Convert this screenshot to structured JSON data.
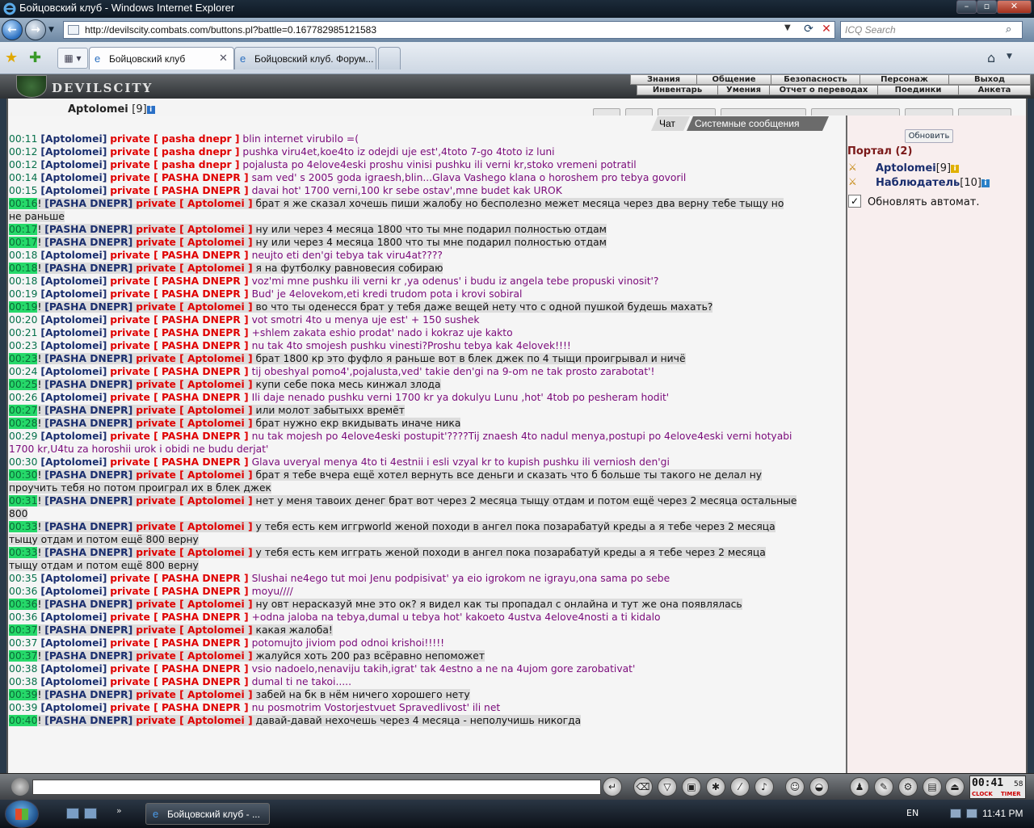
{
  "window": {
    "title": "Бойцовский клуб - Windows Internet Explorer"
  },
  "browser": {
    "url": "http://devilscity.combats.com/buttons.pl?battle=0.167782985121583",
    "search_placeholder": "ICQ Search",
    "tabs": [
      {
        "label": "Бойцовский клуб",
        "active": true
      },
      {
        "label": "Бойцовский клуб. Форум...",
        "active": false
      }
    ]
  },
  "game": {
    "logo_text": "DEVILSCITY",
    "menu_top": [
      "Знания",
      "Общение",
      "Безопасность",
      "Персонаж",
      "Выход"
    ],
    "menu_bottom": [
      "Инвентарь",
      "Умения",
      "Отчет о переводах",
      "Поединки",
      "Анкета"
    ],
    "user": {
      "name": "Aptolomei",
      "level": "[9]"
    }
  },
  "chat": {
    "tabs": [
      "Чат",
      "Системные сообщения"
    ],
    "messages": [
      {
        "time": "00:11",
        "hl": false,
        "from": "Aptolomei",
        "to": "pasha dnepr",
        "text": "blin internet virubilo =(",
        "dir": "out"
      },
      {
        "time": "00:12",
        "hl": false,
        "from": "Aptolomei",
        "to": "pasha dnepr",
        "text": "pushka viru4et,koe4to iz odejdi uje est',4toto 7-go 4toto iz luni",
        "dir": "out"
      },
      {
        "time": "00:12",
        "hl": false,
        "from": "Aptolomei",
        "to": "pasha dnepr",
        "text": "pojalusta po 4elove4eski proshu vinisi pushku ili verni kr,stoko vremeni potratil",
        "dir": "out"
      },
      {
        "time": "00:14",
        "hl": false,
        "from": "Aptolomei",
        "to": "PASHA DNEPR",
        "text": "sam ved' s 2005 goda igraesh,blin...Glava Vashego klana o horoshem pro tebya govoril",
        "dir": "out"
      },
      {
        "time": "00:15",
        "hl": false,
        "from": "Aptolomei",
        "to": "PASHA DNEPR",
        "text": "davai hot' 1700 verni,100 kr sebe ostav',mne budet kak UROK",
        "dir": "out"
      },
      {
        "time": "00:16",
        "hl": true,
        "from": "PASHA DNEPR",
        "to": "Aptolomei",
        "text": "брат я же сказал хочешь пиши жалобу но бесполезно межет месяца через два верну тебе тыщу но",
        "cont": "не раньше",
        "dir": "in"
      },
      {
        "time": "00:17",
        "hl": true,
        "from": "PASHA DNEPR",
        "to": "Aptolomei",
        "text": "ну или через 4 месяца 1800 что ты мне подарил полностью отдам",
        "dir": "in"
      },
      {
        "time": "00:17",
        "hl": true,
        "from": "PASHA DNEPR",
        "to": "Aptolomei",
        "text": "ну или через 4 месяца 1800 что ты мне подарил полностью отдам",
        "dir": "in"
      },
      {
        "time": "00:18",
        "hl": false,
        "from": "Aptolomei",
        "to": "PASHA DNEPR",
        "text": "neujto eti den'gi tebya tak viru4at????",
        "dir": "out"
      },
      {
        "time": "00:18",
        "hl": true,
        "from": "PASHA DNEPR",
        "to": "Aptolomei",
        "text": "я на футболку равновесия собираю",
        "dir": "in"
      },
      {
        "time": "00:18",
        "hl": false,
        "from": "Aptolomei",
        "to": "PASHA DNEPR",
        "text": "voz'mi mne pushku ili verni kr ,ya odenus' i budu iz angela tebe propuski vinosit'?",
        "dir": "out"
      },
      {
        "time": "00:19",
        "hl": false,
        "from": "Aptolomei",
        "to": "PASHA DNEPR",
        "text": "Bud' je 4elovekom,eti kredi trudom pota i krovi sobiral",
        "dir": "out"
      },
      {
        "time": "00:19",
        "hl": true,
        "from": "PASHA DNEPR",
        "to": "Aptolomei",
        "text": "во что ты оденесся брат у тебя даже вещей нету что с одной пушкой будешь махать?",
        "dir": "in"
      },
      {
        "time": "00:20",
        "hl": false,
        "from": "Aptolomei",
        "to": "PASHA DNEPR",
        "text": "vot smotri 4to u menya uje est' + 150 sushek",
        "dir": "out"
      },
      {
        "time": "00:21",
        "hl": false,
        "from": "Aptolomei",
        "to": "PASHA DNEPR",
        "text": "+shlem zakata eshio prodat' nado i kokraz uje kakto",
        "dir": "out"
      },
      {
        "time": "00:23",
        "hl": false,
        "from": "Aptolomei",
        "to": "PASHA DNEPR",
        "text": "nu tak 4to smojesh pushku vinesti?Proshu tebya kak 4elovek!!!!",
        "dir": "out"
      },
      {
        "time": "00:23",
        "hl": true,
        "from": "PASHA DNEPR",
        "to": "Aptolomei",
        "text": "брат 1800 кр это фуфло я раньше вот в блек джек по 4 тыщи проигрывал и ничё",
        "dir": "in"
      },
      {
        "time": "00:24",
        "hl": false,
        "from": "Aptolomei",
        "to": "PASHA DNEPR",
        "text": "tij obeshyal pomo4',pojalusta,ved' takie den'gi na 9-om ne tak prosto zarabotat'!",
        "dir": "out"
      },
      {
        "time": "00:25",
        "hl": true,
        "from": "PASHA DNEPR",
        "to": "Aptolomei",
        "text": "купи себе пока месь кинжал злода",
        "dir": "in"
      },
      {
        "time": "00:26",
        "hl": false,
        "from": "Aptolomei",
        "to": "PASHA DNEPR",
        "text": "Ili daje nenado pushku verni 1700 kr ya dokulyu Lunu ,hot' 4tob po pesheram hodit'",
        "dir": "out"
      },
      {
        "time": "00:27",
        "hl": true,
        "from": "PASHA DNEPR",
        "to": "Aptolomei",
        "text": "или молот забытыхх времёт",
        "dir": "in"
      },
      {
        "time": "00:28",
        "hl": true,
        "from": "PASHA DNEPR",
        "to": "Aptolomei",
        "text": "брат нужно екр вкидывать иначе ника",
        "dir": "in"
      },
      {
        "time": "00:29",
        "hl": false,
        "from": "Aptolomei",
        "to": "PASHA DNEPR",
        "text": "nu tak mojesh po 4elove4eski postupit'????Tij znaesh 4to nadul menya,postupi po 4elove4eski verni hotyabi",
        "cont": "1700 kr,U4tu za horoshii urok i obidi ne budu derjat'",
        "dir": "out"
      },
      {
        "time": "00:30",
        "hl": false,
        "from": "Aptolomei",
        "to": "PASHA DNEPR",
        "text": "Glava uveryal menya 4to ti 4estnii i esli vzyal kr to kupish pushku ili verniosh den'gi",
        "dir": "out"
      },
      {
        "time": "00:30",
        "hl": true,
        "from": "PASHA DNEPR",
        "to": "Aptolomei",
        "text": "брат я тебе вчера ещё хотел вернуть все деньги и сказать что б больше ты такого не делал ну",
        "cont": "проучить тебя но потом проиграл их в блек джек",
        "dir": "in"
      },
      {
        "time": "00:31",
        "hl": true,
        "from": "PASHA DNEPR",
        "to": "Aptolomei",
        "text": "нет у меня тавоих денег брат вот через 2 месяца тыщу отдам и потом ещё через 2 месяца остальные",
        "cont": "800",
        "dir": "in"
      },
      {
        "time": "00:33",
        "hl": true,
        "from": "PASHA DNEPR",
        "to": "Aptolomei",
        "text": "у тебя есть кем иггрworld женой походи в ангел пока позарабатуй креды а я тебе через 2 месяца",
        "cont": "тыщу отдам и потом ещё 800 верну",
        "dir": "in"
      },
      {
        "time": "00:33",
        "hl": true,
        "from": "PASHA DNEPR",
        "to": "Aptolomei",
        "text": "у тебя есть кем игграть женой походи в ангел пока позарабатуй креды а я тебе через 2 месяца",
        "cont": "тыщу отдам и потом ещё 800 верну",
        "dir": "in"
      },
      {
        "time": "00:35",
        "hl": false,
        "from": "Aptolomei",
        "to": "PASHA DNEPR",
        "text": "Slushai ne4ego tut moi Jenu podpisivat' ya eio igrokom ne igrayu,ona sama po sebe",
        "dir": "out"
      },
      {
        "time": "00:36",
        "hl": false,
        "from": "Aptolomei",
        "to": "PASHA DNEPR",
        "text": "moyu////",
        "dir": "out"
      },
      {
        "time": "00:36",
        "hl": true,
        "from": "PASHA DNEPR",
        "to": "Aptolomei",
        "text": "ну овт нерасказуй мне это ок? я видел как ты пропадал с онлайна и тут же она появлялась",
        "dir": "in"
      },
      {
        "time": "00:36",
        "hl": false,
        "from": "Aptolomei",
        "to": "PASHA DNEPR",
        "text": "+odna jaloba na tebya,dumal u tebya hot' kakoeto 4ustva 4elove4nosti a ti kidalo",
        "dir": "out"
      },
      {
        "time": "00:37",
        "hl": true,
        "from": "PASHA DNEPR",
        "to": "Aptolomei",
        "text": "какая жалоба!",
        "dir": "in"
      },
      {
        "time": "00:37",
        "hl": false,
        "from": "Aptolomei",
        "to": "PASHA DNEPR",
        "text": "potomujto jiviom pod odnoi krishoi!!!!!",
        "dir": "out"
      },
      {
        "time": "00:37",
        "hl": true,
        "from": "PASHA DNEPR",
        "to": "Aptolomei",
        "text": "жалуйся хоть 200 раз всёравно непоможет",
        "dir": "in"
      },
      {
        "time": "00:38",
        "hl": false,
        "from": "Aptolomei",
        "to": "PASHA DNEPR",
        "text": "vsio nadoelo,nenaviju takih,igrat' tak 4estno a ne na 4ujom gore zarobativat'",
        "dir": "out"
      },
      {
        "time": "00:38",
        "hl": false,
        "from": "Aptolomei",
        "to": "PASHA DNEPR",
        "text": "dumal ti ne takoi.....",
        "dir": "out"
      },
      {
        "time": "00:39",
        "hl": true,
        "from": "PASHA DNEPR",
        "to": "Aptolomei",
        "text": "забей на бк в нём ничего хорошего нету",
        "dir": "in"
      },
      {
        "time": "00:39",
        "hl": false,
        "from": "Aptolomei",
        "to": "PASHA DNEPR",
        "text": "nu posmotrim Vostorjestvuet Spravedlivost' ili net",
        "dir": "out"
      },
      {
        "time": "00:40",
        "hl": true,
        "from": "PASHA DNEPR",
        "to": "Aptolomei",
        "text": "давай-давай нехочешь через 4 месяца - неполучишь никогда",
        "dir": "in"
      }
    ],
    "private_word": "private"
  },
  "right_panel": {
    "refresh_label": "Обновить",
    "portal_title": "Портал (2)",
    "players": [
      {
        "name": "Aptolomei",
        "level": "[9]",
        "info_color": "#e0b000"
      },
      {
        "name": "Наблюдатель",
        "level": "[10]",
        "info_color": "#2a80c7"
      }
    ],
    "auto_update_label": "Обновлять автомат.",
    "auto_update_checked": true
  },
  "bottom": {
    "clock_time": "00:41",
    "clock_seconds": "58",
    "clock_label": "CLOCK",
    "timer_label": "TIMER"
  },
  "taskbar": {
    "task_label": "Бойцовский клуб - ...",
    "lang": "EN",
    "time": "11:41 PM"
  }
}
